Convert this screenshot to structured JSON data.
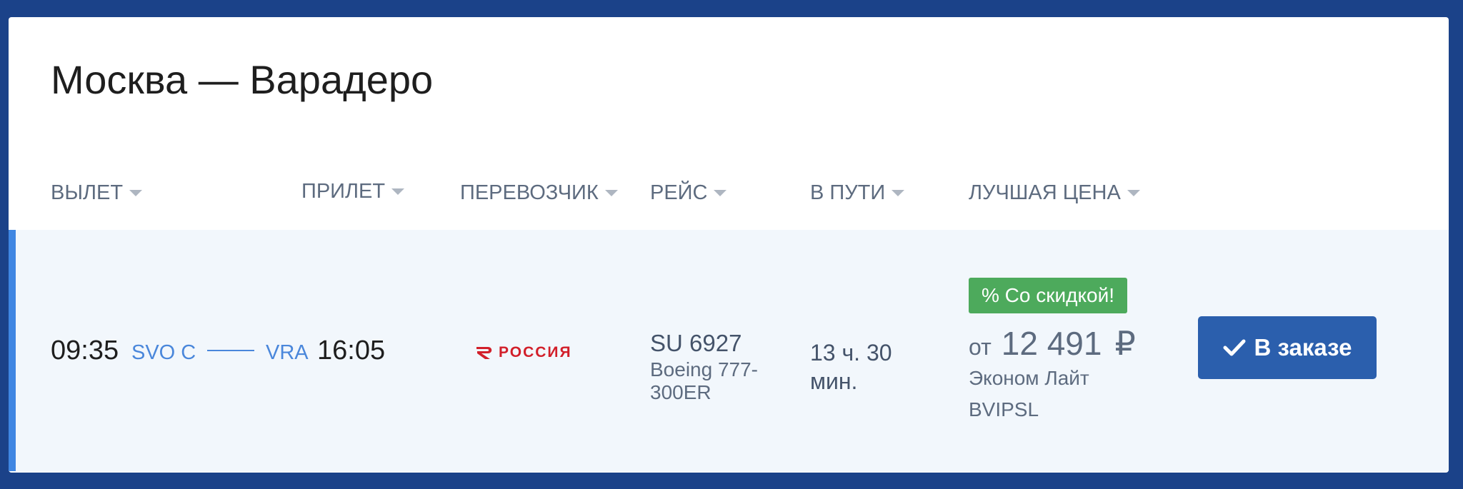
{
  "route": {
    "title": "Москва — Варадеро"
  },
  "columns": [
    {
      "label": "ВЫЛЕТ"
    },
    {
      "label": "ПРИЛЕТ"
    },
    {
      "label": "ПЕРЕВОЗЧИК"
    },
    {
      "label": "РЕЙС"
    },
    {
      "label": "В ПУТИ"
    },
    {
      "label": "ЛУЧШАЯ ЦЕНА"
    }
  ],
  "flight": {
    "departure_time": "09:35",
    "departure_airport": "SVO C",
    "arrival_airport": "VRA",
    "arrival_time": "16:05",
    "carrier_logo_text": "РОССИЯ",
    "flight_number": "SU 6927",
    "aircraft": "Boeing 777-300ER",
    "duration": "13 ч. 30 мин.",
    "discount_label": "% Со скидкой!",
    "price_prefix": "от",
    "price_value": "12 491",
    "price_currency": "₽",
    "fare_name": "Эконом Лайт",
    "fare_code": "BVIPSL",
    "order_label": "В заказе"
  },
  "colors": {
    "background": "#1b4289",
    "row_accent": "#3f86e2",
    "airport_text": "#4a87db",
    "discount_badge": "#4daa5c",
    "order_button": "#2b5fad",
    "brand_red": "#d21f2a"
  },
  "icons": {
    "sort": "caret-down-icon",
    "carrier": "rossiya-logo-icon",
    "order": "checkmark-icon"
  }
}
